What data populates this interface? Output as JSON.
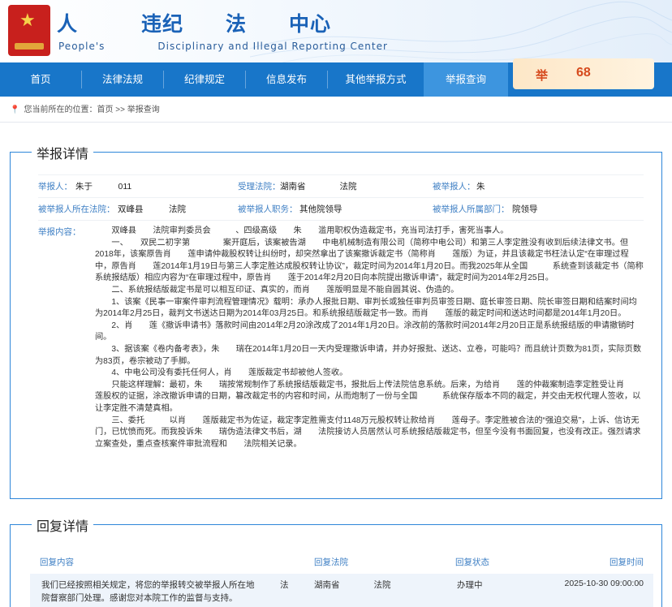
{
  "header": {
    "title": "人　　　违纪　　法　　中心",
    "subtitle": "People's　　　　　Disciplinary and Illegal Reporting Center"
  },
  "nav": {
    "items": [
      "首页",
      "法律法规",
      "纪律规定",
      "信息发布",
      "其他举报方式",
      "举报查询"
    ],
    "active": "举报查询"
  },
  "hotline": {
    "label": "举",
    "number": "68"
  },
  "breadcrumb": "您当前所在的位置：首页  >> 举报查询",
  "detail": {
    "title": "举报详情",
    "reporter_label": "举报人：",
    "reporter_value": "朱于　　　011",
    "court_label": "受理法院：",
    "court_value": "湖南省　　　　法院",
    "reported_label": "被举报人：",
    "reported_value": "朱",
    "location_label": "被举报人所在法院：",
    "location_value": "双峰县　　　法院",
    "duty_label": "被举报人职务：",
    "duty_value": "其他院领导",
    "dept_label": "被举报人所属部门：",
    "dept_value": "院领导",
    "content_label": "举报内容：",
    "paragraphs": [
      "双峰县　　法院审判委员会　　　、四级高级　　朱　　滥用职权伪造裁定书，充当司法打手，害死当事人。",
      "一、　　双民二初字第　　　　案开庭后，该案被告湖　　中电机械制造有限公司（简称中电公司）和第三人李定胜没有收到后续法律文书。但2018年，该案原告肖　　莲申请仲裁股权转让纠纷时，却突然拿出了该案撤诉裁定书（简称肖　　莲版）为证，并且该裁定书枉法认定“在审理过程中，原告肖　　莲2014年1月19日与第三人李定胜达成股权转让协议”，裁定时间为2014年1月20日。而我2025年从全国　　　系统查到该裁定书（简称系统报结版）相应内容为“在审理过程中，原告肖　　莲于2014年2月20日向本院提出撤诉申请”，裁定时间为2014年2月25日。",
      "二、系统报结版裁定书是可以相互印证、真实的，而肖　　莲版明显是不能自圆其说、伪造的。",
      "1、该案《民事一审案件审判流程管理情况》载明：承办人报批日期、审判长或独任审判员审签日期、庭长审签日期、院长审签日期和结案时间均为2014年2月25日，裁判文书送达日期为2014年03月25日。和系统报结版裁定书一致。而肖　　莲版的裁定时间和送达时间都是2014年1月20日。",
      "2、肖　　莲《撤诉申请书》落款时间由2014年2月20涂改成了2014年1月20日。涂改前的落款时间2014年2月20日正是系统报结版的申请撤销时间。",
      "3、据该案《卷内备考表》，朱　　瑞在2014年1月20日一天内受理撤诉申请，并办好报批、送达、立卷，可能吗？而且统计页数为81页，实际页数为83页，卷宗被动了手脚。",
      "4、中电公司没有委托任何人，肖　　莲版裁定书却被他人签收。",
      "只能这样理解：最初，朱　　瑞按常规制作了系统报结版裁定书，报批后上传法院信息系统。后来，为给肖　　莲的仲裁案制造李定胜受让肖　　莲股权的证据，涂改撤诉申请的日期，篡改裁定书的内容和时间，从而炮制了一份与全国　　　系统保存版本不同的裁定，并交由无权代理人签收，以让李定胜不清楚真相。",
      "三、委托　　　以肖　　莲版裁定书为佐证，裁定李定胜需支付1148万元股权转让款给肖　　莲母子。李定胜被合法的“强迫交易”，上诉、信访无门，已忧愤而死。而我投诉朱　　瑞伪造法律文书后，湖　　法院接访人员居然认可系统报结版裁定书，但至今没有书面回复，也没有改正。强烈请求立案查处，重点查核案件审批流程和　　法院相关记录。"
    ]
  },
  "reply": {
    "title": "回复详情",
    "headers": [
      "回复内容",
      "回复法院",
      "回复状态",
      "回复时间"
    ],
    "content_line1": "我们已经按照相关规定，将您的举报转交被举报人所在地　　　法",
    "content_line2": "院督察部门处理。感谢您对本院工作的监督与支持。",
    "court": "湖南省　　　　法院",
    "status": "办理中",
    "time": "2025-10-30 09:00:00"
  },
  "colors": {
    "nav": "#1876c9",
    "nav_active": "#3d95df",
    "label": "#3e7fc4",
    "panel_border": "#2e86d9"
  }
}
